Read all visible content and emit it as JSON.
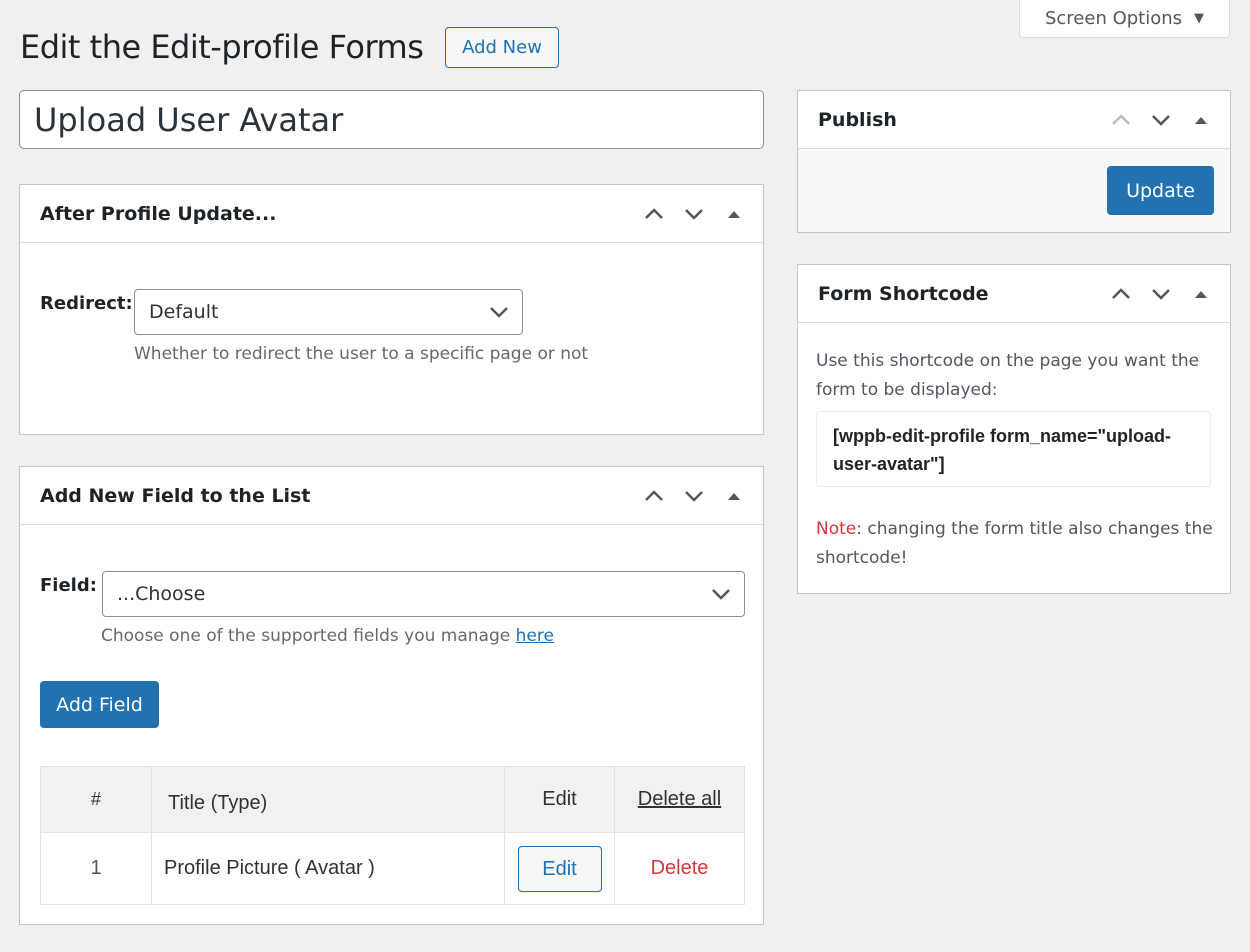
{
  "screen_options": {
    "label": "Screen Options"
  },
  "header": {
    "title": "Edit the Edit-profile Forms",
    "add_new": "Add New"
  },
  "form_title": {
    "value": "Upload User Avatar"
  },
  "after_update": {
    "title": "After Profile Update...",
    "redirect_label": "Redirect:",
    "redirect_value": "Default",
    "redirect_desc": "Whether to redirect the user to a specific page or not"
  },
  "add_field": {
    "title": "Add New Field to the List",
    "field_label": "Field:",
    "field_value": "...Choose",
    "field_desc": "Choose one of the supported fields you manage",
    "field_desc_link": "here",
    "button": "Add Field"
  },
  "fields_table": {
    "headers": [
      "#",
      "Title (Type)",
      "Edit",
      "Delete all"
    ],
    "rows": [
      {
        "num": "1",
        "title": "Profile Picture ( Avatar )",
        "edit": "Edit",
        "delete": "Delete"
      }
    ]
  },
  "publish": {
    "title": "Publish",
    "update": "Update"
  },
  "shortcode": {
    "title": "Form Shortcode",
    "desc": "Use this shortcode on the page you want the form to be displayed:",
    "code": "[wppb-edit-profile form_name=\"upload-user-avatar\"]",
    "note_label": "Note",
    "note_text": ": changing the form title also changes the shortcode!"
  },
  "colors": {
    "accent": "#2271b1",
    "danger": "#d63638"
  }
}
